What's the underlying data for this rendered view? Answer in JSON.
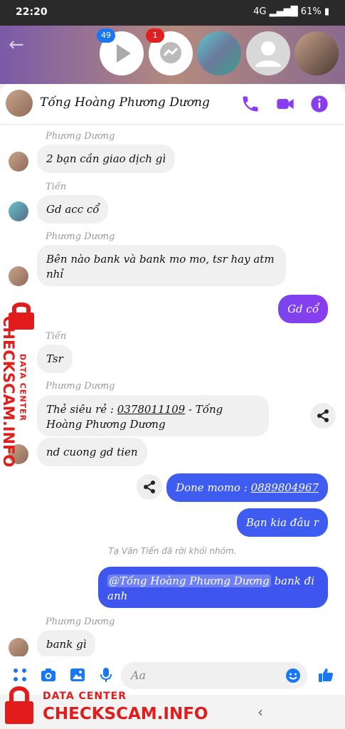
{
  "status_bar": {
    "time": "22:20",
    "network": "4G",
    "battery": "61%"
  },
  "chat_heads": [
    {
      "name": "video-chathead",
      "badge": "49",
      "badge_color": "#1877f2"
    },
    {
      "name": "messenger-chathead",
      "badge": "1",
      "badge_color": "#e02020"
    },
    {
      "name": "group-chathead"
    },
    {
      "name": "default-user-chathead"
    },
    {
      "name": "user-photo-chathead"
    }
  ],
  "conversation": {
    "title": "Tống Hoàng Phương Dương"
  },
  "colors": {
    "accent": "#8a3cf0",
    "messenger_blue": "#1877f2",
    "bubble_gray": "#f0f0f0",
    "my_bubble_start": "#3f6cf0",
    "my_bubble_end": "#8a3cf0"
  },
  "messages": [
    {
      "sender": "Phương Dương",
      "text": "2 bạn cần giao dịch gì"
    },
    {
      "sender": "Tiến",
      "text": "Gd acc cổ"
    },
    {
      "sender": "Phương Dương",
      "text": "Bên nào bank và bank mo mo, tsr hay atm nhỉ"
    },
    {
      "sender": "me",
      "text": "Gd cổ"
    },
    {
      "sender": "Tiến",
      "text": "Tsr"
    },
    {
      "sender": "Phương Dương",
      "text_prefix": "Thẻ siêu rẻ : ",
      "phone": "0378011109",
      "text_suffix": " - Tống Hoàng Phương Dương"
    },
    {
      "sender": "Phương Dương",
      "text": "nd cuong gd tien"
    },
    {
      "sender": "me",
      "text_prefix": "Done momo : ",
      "phone": "0889804967"
    },
    {
      "sender": "me",
      "text": "Bạn kia đâu r"
    },
    {
      "sender": "me",
      "mention": "@Tống Hoàng Phương Dương",
      "text_suffix": " bank đi anh"
    },
    {
      "sender": "Phương Dương",
      "text": "bank gì"
    }
  ],
  "system_message": "Tạ Văn Tiến đã rời khỏi nhóm.",
  "composer": {
    "placeholder": "Aa"
  },
  "watermark": {
    "line1": "DATA CENTER",
    "line2": "CHECKSCAM.INFO",
    "color": "#e21b1b"
  }
}
